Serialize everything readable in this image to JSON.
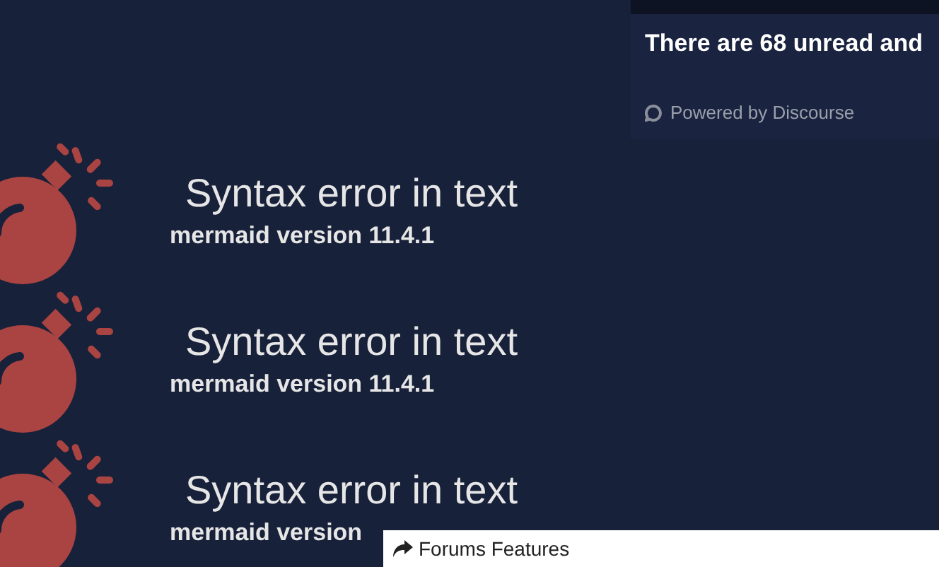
{
  "sidebar_panel": {
    "unread_text": "There are 68 unread and",
    "powered_by": "Powered by Discourse"
  },
  "errors": [
    {
      "title": "Syntax error in text",
      "version": "mermaid version 11.4.1"
    },
    {
      "title": "Syntax error in text",
      "version": "mermaid version 11.4.1"
    },
    {
      "title": "Syntax error in text",
      "version": "mermaid version"
    }
  ],
  "popup": {
    "title": "Forums Features"
  }
}
